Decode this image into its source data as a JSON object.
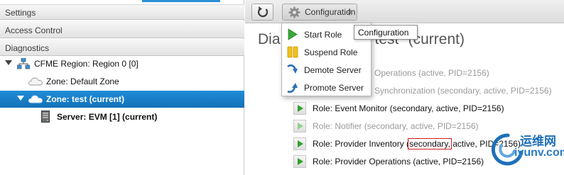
{
  "sidebar": {
    "settings_label": "Settings",
    "access_control_label": "Access Control",
    "diagnostics_label": "Diagnostics",
    "tree": [
      {
        "label": "CFME Region: Region 0 [0]",
        "icon": "region-icon"
      },
      {
        "label": "Zone: Default Zone",
        "icon": "cloud-icon"
      },
      {
        "label": "Zone: test (current)",
        "icon": "cloud-icon",
        "selected": true
      },
      {
        "label": "Server: EVM [1] (current)",
        "icon": "server-icon"
      }
    ]
  },
  "toolbar": {
    "refresh_icon": "refresh-icon",
    "configuration_label": "Configuration",
    "tooltip": "Configuration"
  },
  "config_menu": {
    "items": [
      {
        "label": "Start Role",
        "icon": "start-role-icon"
      },
      {
        "label": "Suspend Role",
        "icon": "suspend-role-icon"
      },
      {
        "label": "Demote Server",
        "icon": "demote-server-icon"
      },
      {
        "label": "Promote Server",
        "icon": "promote-server-icon"
      }
    ]
  },
  "main": {
    "title_left": "Dia",
    "title_right": "e \"test\" (current)",
    "roles": [
      {
        "text": "Operations (active, PID=2156)",
        "dim": true
      },
      {
        "text": "Synchronization (secondary, active, PID=2156)",
        "dim": true
      },
      {
        "text": "Role: Event Monitor (secondary, active, PID=2156)",
        "dim": false
      },
      {
        "text": "Role: Notifier (secondary, active, PID=2156)",
        "dim": true
      },
      {
        "text_before": "Role: Provider Inventory (",
        "highlight": "secondary,",
        "text_after": " active, PID=2156)",
        "dim": false
      },
      {
        "text": "Role: Provider Operations (active, PID=2156)",
        "dim": false
      }
    ]
  },
  "watermark": {
    "cn": "运维网",
    "url": "iyunv.com"
  },
  "colors": {
    "selection": "#1a7fcb",
    "play_green": "#31a02f",
    "highlight_border": "#d51b1b"
  }
}
